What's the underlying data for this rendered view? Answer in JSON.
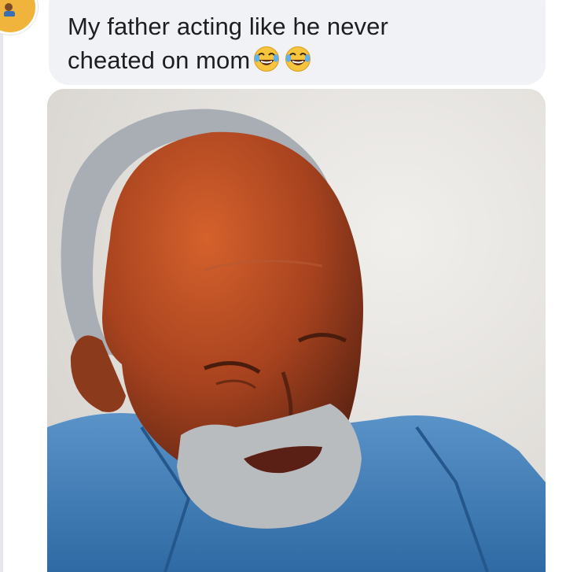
{
  "post": {
    "message_line1": "My father acting like he never",
    "message_line2": "cheated on mom",
    "emoji": [
      "face-with-tears-of-joy-icon",
      "face-with-tears-of-joy-icon"
    ]
  },
  "colors": {
    "bubble_bg": "#f0f2f5",
    "text": "#1c1e21",
    "avatar_bg": "#f0b43c",
    "emoji_yellow": "#f7c53c"
  }
}
